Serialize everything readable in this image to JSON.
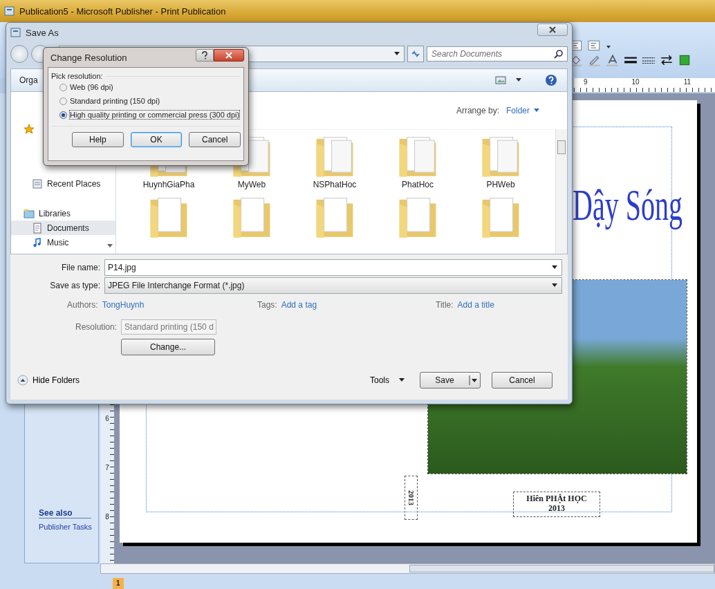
{
  "app": {
    "title": "Publication5 - Microsoft Publisher - Print Publication"
  },
  "ruler": {
    "h_marks": [
      "9",
      "10",
      "11"
    ],
    "v_marks": [
      "6",
      "7",
      "8"
    ]
  },
  "task_pane": {
    "heading": "See also",
    "links": [
      "Publisher Tasks"
    ]
  },
  "page": {
    "wordart": "Dậy Sóng",
    "vertical_text": "2013",
    "caption_lines": [
      "Hiên PHẬt HỌC",
      "2013"
    ]
  },
  "page_tab": "1",
  "save_as": {
    "title": "Save As",
    "search": {
      "placeholder": "Search Documents"
    },
    "command": "Orga",
    "nav": [
      {
        "label": "Recent Places",
        "kind": "recent",
        "selected": false
      },
      {
        "label": "Libraries",
        "kind": "libraries",
        "selected": false
      },
      {
        "label": "Documents",
        "kind": "documents",
        "selected": true
      },
      {
        "label": "Music",
        "kind": "music",
        "selected": false
      }
    ],
    "arrange": {
      "label": "Arrange by:",
      "value": "Folder"
    },
    "folders": [
      {
        "name": "HuynhGiaPha"
      },
      {
        "name": "MyWeb"
      },
      {
        "name": "NSPhatHoc"
      },
      {
        "name": "PhatHoc"
      },
      {
        "name": "PHWeb"
      }
    ],
    "file_name": {
      "label": "File name:",
      "value": "P14.jpg"
    },
    "save_type": {
      "label": "Save as type:",
      "value": "JPEG File Interchange Format (*.jpg)"
    },
    "meta": [
      {
        "label": "Authors:",
        "value": "TongHuynh"
      },
      {
        "label": "Tags:",
        "value": "Add a tag"
      },
      {
        "label": "Title:",
        "value": "Add a title"
      }
    ],
    "resolution": {
      "label": "Resolution:",
      "value": "Standard printing (150 d"
    },
    "change_button": "Change...",
    "hide_folders": "Hide Folders",
    "tools": "Tools",
    "save": "Save",
    "cancel": "Cancel"
  },
  "change_resolution": {
    "title": "Change Resolution",
    "group_label": "Pick resolution:",
    "options": [
      {
        "label": "Web (96 dpi)",
        "selected": false
      },
      {
        "label": "Standard printing (150 dpi)",
        "selected": false
      },
      {
        "label": "High quality printing or commercial press (300 dpi)",
        "selected": true
      }
    ],
    "buttons": [
      {
        "label": "Help",
        "default": false
      },
      {
        "label": "OK",
        "default": true
      },
      {
        "label": "Cancel",
        "default": false
      }
    ]
  }
}
